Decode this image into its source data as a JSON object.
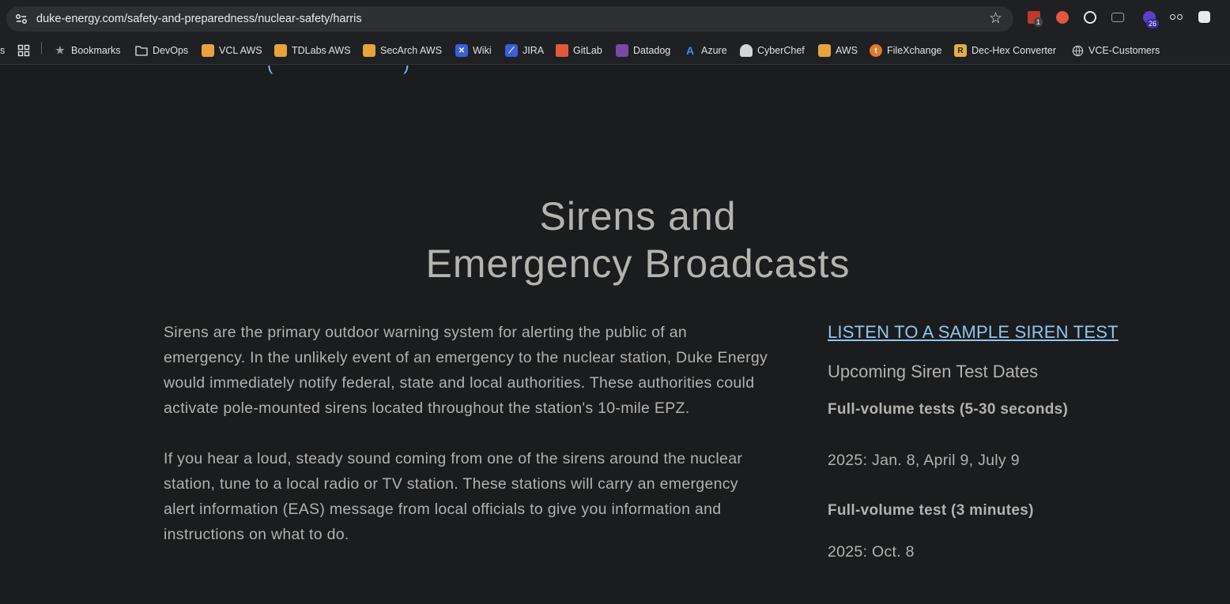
{
  "browser": {
    "url": "duke-energy.com/safety-and-preparedness/nuclear-safety/harris",
    "extension_badges": [
      "1",
      "26"
    ]
  },
  "bookmarks": {
    "leading_fragment": "s",
    "items": [
      {
        "label": "Bookmarks",
        "icon": "star-icon"
      },
      {
        "label": "DevOps",
        "icon": "folder-icon"
      },
      {
        "label": "VCL AWS",
        "icon": "aws-cube-icon"
      },
      {
        "label": "TDLabs AWS",
        "icon": "aws-cube-icon"
      },
      {
        "label": "SecArch AWS",
        "icon": "aws-cube-icon"
      },
      {
        "label": "Wiki",
        "icon": "confluence-icon"
      },
      {
        "label": "JIRA",
        "icon": "jira-icon"
      },
      {
        "label": "GitLab",
        "icon": "gitlab-icon"
      },
      {
        "label": "Datadog",
        "icon": "datadog-icon"
      },
      {
        "label": "Azure",
        "icon": "azure-icon"
      },
      {
        "label": "CyberChef",
        "icon": "chef-hat-icon"
      },
      {
        "label": "AWS",
        "icon": "aws-cube-icon"
      },
      {
        "label": "FileXchange",
        "icon": "filexchange-icon"
      },
      {
        "label": "Dec-Hex Converter",
        "icon": "r-icon"
      },
      {
        "label": "VCE-Customers",
        "icon": "globe-icon"
      }
    ]
  },
  "page": {
    "title_line1": "Sirens and",
    "title_line2": "Emergency Broadcasts",
    "paragraph1": "Sirens are the primary outdoor warning system for alerting the public of an emergency. In the unlikely event of an emergency to the nuclear station, Duke Energy would immediately notify federal, state and local authorities. These authorities could activate pole-mounted sirens located throughout the station's 10-mile EPZ.",
    "paragraph2": "If you hear a loud, steady sound coming from one of the sirens around the nuclear station, tune to a local radio or TV station. These stations will carry an emergency alert information (EAS) message from local officials to give you information and instructions on what to do.",
    "sidebar": {
      "listen_link": "LISTEN TO A SAMPLE SIREN TEST",
      "upcoming_heading": "Upcoming Siren Test Dates",
      "test1_heading": "Full-volume tests (5-30 seconds)",
      "test1_dates": "2025: Jan. 8, April 9, July 9",
      "test2_heading": "Full-volume test (3 minutes)",
      "test2_dates": "2025: Oct. 8"
    }
  },
  "colors": {
    "page_bg": "#1b1c1e",
    "text": "#b3b2ad",
    "link": "#8fc6ee",
    "toolbar_bg": "#1f2023",
    "omnibox_bg": "#2e2f33"
  }
}
